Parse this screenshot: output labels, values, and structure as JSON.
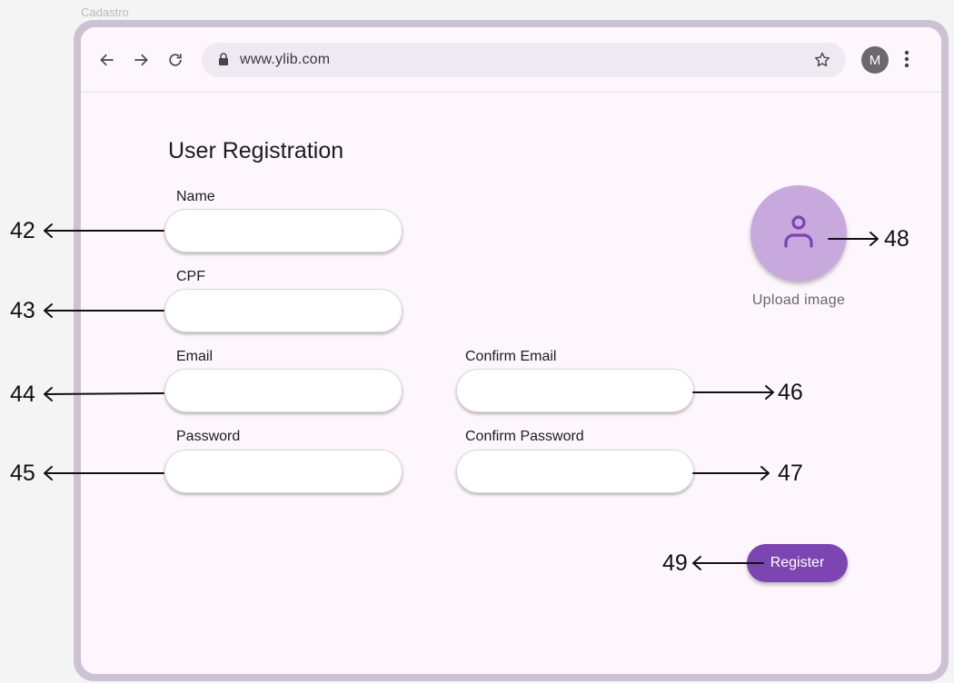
{
  "frame": {
    "title": "Cadastro"
  },
  "browser": {
    "url": "www.ylib.com",
    "avatar_letter": "M",
    "icons": {
      "back": "arrow-left-icon",
      "forward": "arrow-right-icon",
      "reload": "reload-icon",
      "lock": "lock-icon",
      "bookmark": "star-icon",
      "menu": "more-vert-icon"
    }
  },
  "form": {
    "title": "User Registration",
    "fields": {
      "name": {
        "label": "Name",
        "value": ""
      },
      "cpf": {
        "label": "CPF",
        "value": ""
      },
      "email": {
        "label": "Email",
        "value": ""
      },
      "confirm_email": {
        "label": "Confirm Email",
        "value": ""
      },
      "password": {
        "label": "Password",
        "value": ""
      },
      "confirm_password": {
        "label": "Confirm Password",
        "value": ""
      }
    },
    "upload": {
      "label": "Upload image",
      "icon": "person-icon"
    },
    "register_label": "Register"
  },
  "colors": {
    "primary": "#7c45b2",
    "upload_bg": "#c8a9dd",
    "screen_bg": "#fdf7fd",
    "frame": "#cbc3d3"
  },
  "callouts": {
    "name": "42",
    "cpf": "43",
    "email": "44",
    "password": "45",
    "confirm_email": "46",
    "confirm_password": "47",
    "upload": "48",
    "register": "49"
  }
}
